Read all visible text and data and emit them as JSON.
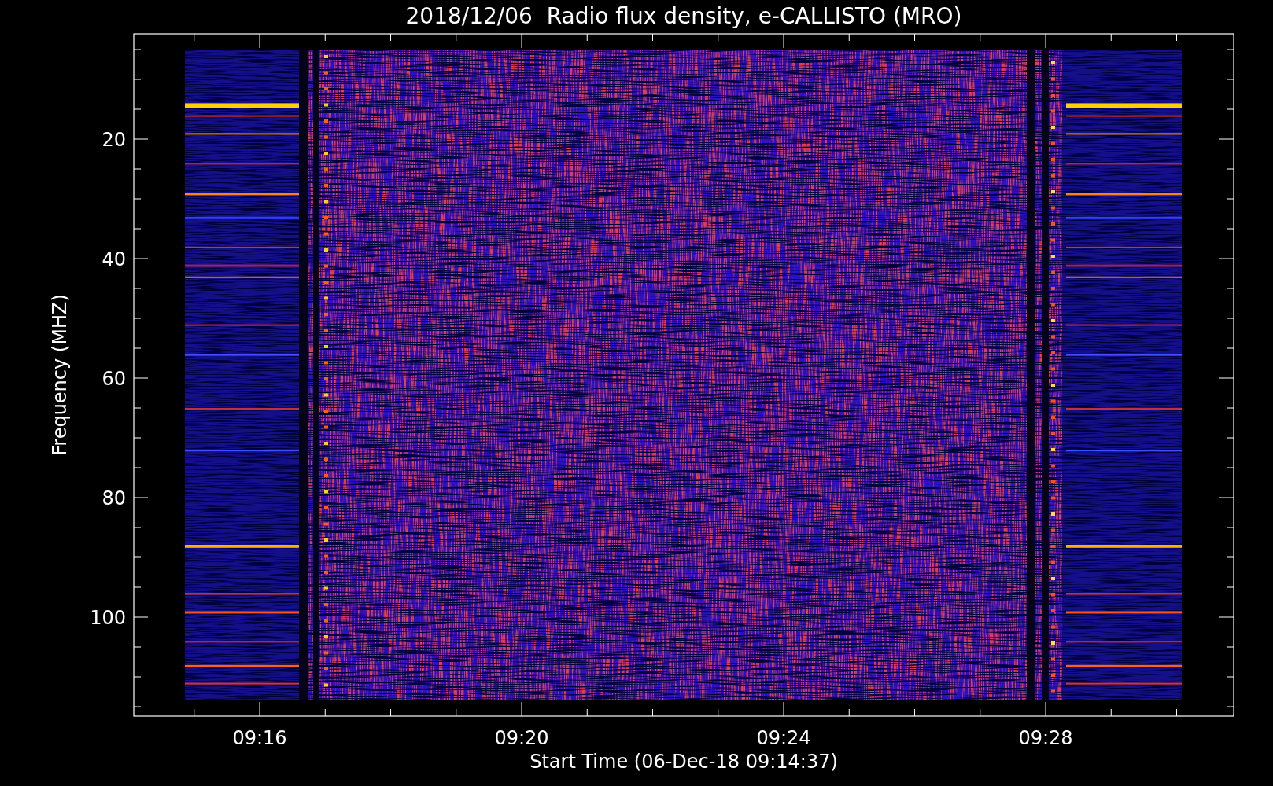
{
  "title": "2018/12/06  Radio flux density, e-CALLISTO (MRO)",
  "xlabel": "Start Time (06-Dec-18 09:14:37)",
  "ylabel": "Frequency (MHZ)",
  "xticks": [
    "09:16",
    "09:20",
    "09:24",
    "09:28"
  ],
  "yticks": [
    "20",
    "40",
    "60",
    "80",
    "100"
  ]
}
